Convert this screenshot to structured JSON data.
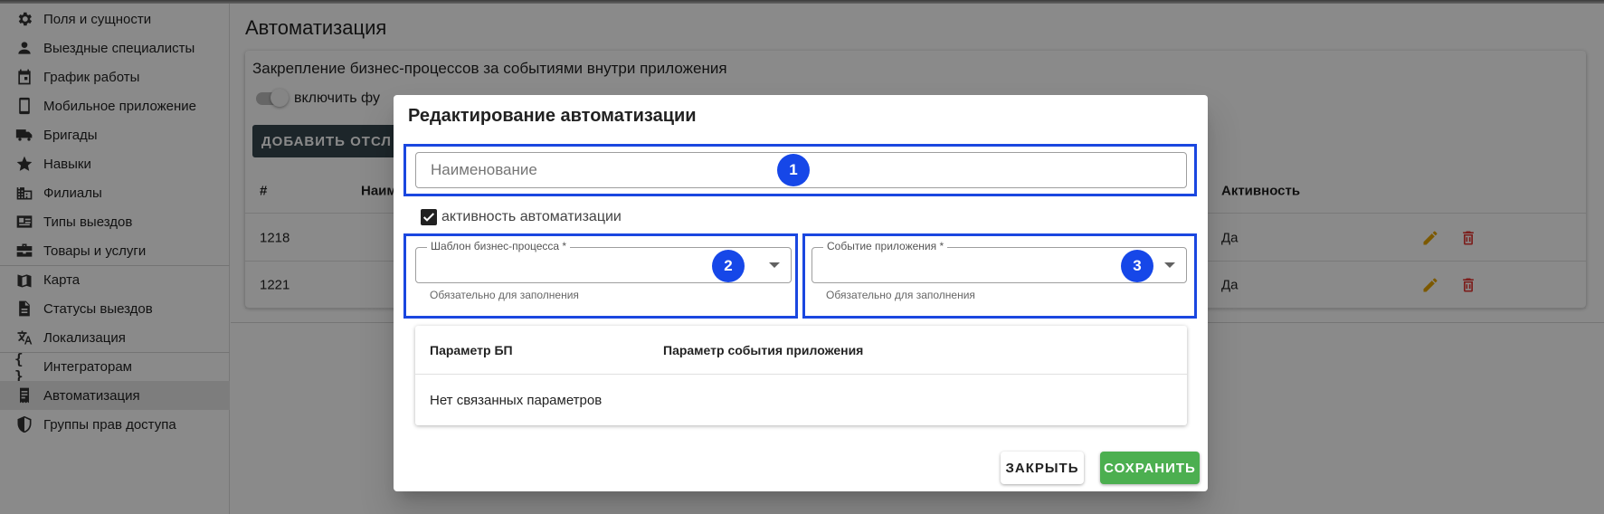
{
  "sidebar": {
    "items": [
      {
        "label": "Поля и сущности",
        "icon": "gear-icon"
      },
      {
        "label": "Выездные специалисты",
        "icon": "person-icon"
      },
      {
        "label": "График работы",
        "icon": "calendar-icon"
      },
      {
        "label": "Мобильное приложение",
        "icon": "phone-icon"
      },
      {
        "label": "Бригады",
        "icon": "truck-icon"
      },
      {
        "label": "Навыки",
        "icon": "star-icon"
      },
      {
        "label": "Филиалы",
        "icon": "building-icon"
      },
      {
        "label": "Типы выездов",
        "icon": "id-card-icon"
      },
      {
        "label": "Товары и услуги",
        "icon": "briefcase-icon"
      },
      {
        "label": "Карта",
        "icon": "map-icon"
      },
      {
        "label": "Статусы выездов",
        "icon": "document-icon"
      },
      {
        "label": "Локализация",
        "icon": "translate-icon"
      },
      {
        "label": "Интеграторам",
        "icon": "braces-icon",
        "glyph": "{ }"
      },
      {
        "label": "Автоматизация",
        "icon": "receipt-icon",
        "active": true
      },
      {
        "label": "Группы прав доступа",
        "icon": "shield-icon"
      }
    ]
  },
  "main": {
    "title": "Автоматизация",
    "card": {
      "title": "Закрепление бизнес-процессов за событиями внутри приложения",
      "switch_label": "включить фу",
      "add_button": "ДОБАВИТЬ ОТСЛ",
      "columns": {
        "num": "#",
        "name": "Наим",
        "active": "Активность"
      },
      "rows": [
        {
          "num": "1218",
          "active": "Да"
        },
        {
          "num": "1221",
          "active": "Да"
        }
      ]
    }
  },
  "dialog": {
    "title": "Редактирование автоматизации",
    "name_placeholder": "Наименование",
    "checkbox_label": "активность автоматизации",
    "checkbox_checked": true,
    "bp_template": {
      "legend": "Шаблон бизнес-процесса *",
      "value": "",
      "helper": "Обязательно для заполнения"
    },
    "app_event": {
      "legend": "Событие приложения *",
      "value": "",
      "helper": "Обязательно для заполнения"
    },
    "params_table": {
      "col_bp": "Параметр БП",
      "col_event": "Параметр события приложения",
      "empty_text": "Нет связанных параметров"
    },
    "close_button": "ЗАКРЫТЬ",
    "save_button": "СОХРАНИТЬ"
  },
  "annotations": {
    "badge_1": "1",
    "badge_2": "2",
    "badge_3": "3",
    "highlight_color": "#1a47e0"
  },
  "colors": {
    "save_green": "#4caf50",
    "edit_orange": "#e6a400",
    "delete_red": "#e53935",
    "dark_button": "#37474f"
  }
}
